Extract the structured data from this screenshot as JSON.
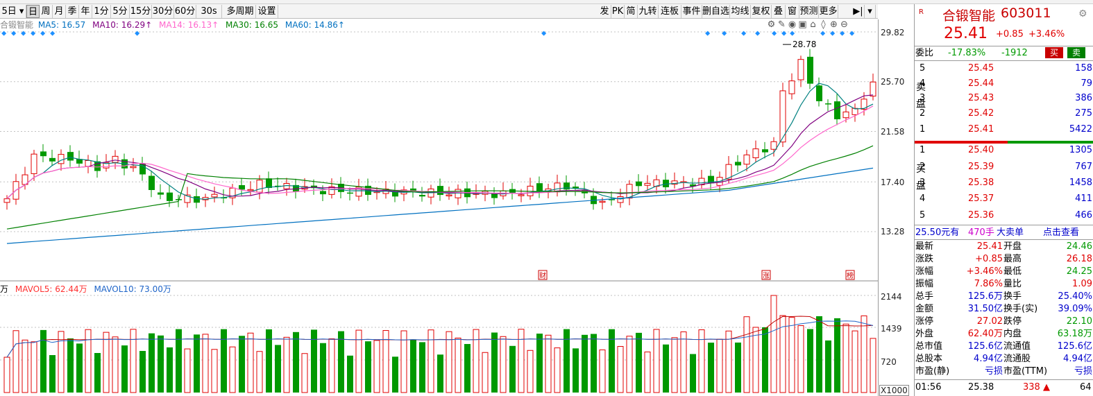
{
  "toolbar": {
    "period_label": "5日",
    "buttons": [
      "日",
      "周",
      "月",
      "季",
      "年",
      "1分",
      "5分",
      "15分",
      "30分",
      "60分",
      "30s",
      "多周期",
      "设置"
    ],
    "active": "日",
    "right_buttons": [
      "发",
      "PK",
      "简",
      "九转",
      "连板",
      "事件",
      "删自选",
      "均线",
      "复权",
      "叠",
      "窗",
      "预测",
      "更多"
    ]
  },
  "chart": {
    "ma_legend": {
      "name": "合锻智能",
      "ma5": "MA5: 16.57",
      "ma10": "MA10: 16.29↑",
      "ma14": "MA14: 16.13↑",
      "ma30": "MA30: 16.65",
      "ma60": "MA60: 14.86↑"
    },
    "price_axis": [
      "29.82",
      "25.70",
      "21.58",
      "17.40",
      "13.28"
    ],
    "high_label": "28.78",
    "event_markers": [
      "财",
      "涨",
      "榜"
    ],
    "vol_legend": {
      "unit": "万",
      "mavol5": "MAVOL5: 62.44万",
      "mavol10": "MAVOL10: 73.00万"
    },
    "vol_axis": [
      "2144",
      "1439",
      "720"
    ],
    "vol_unit": "X1000",
    "colors": {
      "up": "#e00000",
      "down": "#009900",
      "ma5": "#008080",
      "ma10": "#800080",
      "ma14": "#ff66cc",
      "ma30": "#008000",
      "ma60": "#0070c0"
    }
  },
  "panel": {
    "stock_name": "合锻智能",
    "code": "603011",
    "price": "25.41",
    "change": "+0.85",
    "change_pct": "+3.46%",
    "weibi_label": "委比",
    "weibi_pct": "-17.83%",
    "weicha": "-1912",
    "buy_label": "买",
    "sell_label": "卖",
    "sell_side": "卖盘",
    "buy_side": "买盘",
    "asks": [
      {
        "lvl": "5",
        "price": "25.45",
        "vol": "158"
      },
      {
        "lvl": "4",
        "price": "25.44",
        "vol": "79"
      },
      {
        "lvl": "3",
        "price": "25.43",
        "vol": "386"
      },
      {
        "lvl": "2",
        "price": "25.42",
        "vol": "275"
      },
      {
        "lvl": "1",
        "price": "25.41",
        "vol": "5422"
      }
    ],
    "bids": [
      {
        "lvl": "1",
        "price": "25.40",
        "vol": "1305"
      },
      {
        "lvl": "2",
        "price": "25.39",
        "vol": "767"
      },
      {
        "lvl": "3",
        "price": "25.38",
        "vol": "1458"
      },
      {
        "lvl": "4",
        "price": "25.37",
        "vol": "411"
      },
      {
        "lvl": "5",
        "price": "25.36",
        "vol": "466"
      }
    ],
    "bigorder": {
      "price": "25.50元有",
      "qty": "470手",
      "label": "大卖单",
      "link": "点击查看"
    },
    "stats": [
      {
        "l1": "最新",
        "v1": "25.41",
        "c1": "red",
        "l2": "开盘",
        "v2": "24.46",
        "c2": "grn"
      },
      {
        "l1": "涨跌",
        "v1": "+0.85",
        "c1": "red",
        "l2": "最高",
        "v2": "26.18",
        "c2": "red"
      },
      {
        "l1": "涨幅",
        "v1": "+3.46%",
        "c1": "red",
        "l2": "最低",
        "v2": "24.25",
        "c2": "grn"
      },
      {
        "l1": "振幅",
        "v1": "7.86%",
        "c1": "red",
        "l2": "量比",
        "v2": "1.09",
        "c2": "red"
      },
      {
        "l1": "总手",
        "v1": "125.6万",
        "c1": "blu",
        "l2": "换手",
        "v2": "25.40%",
        "c2": "blu"
      },
      {
        "l1": "金额",
        "v1": "31.50亿",
        "c1": "blu",
        "l2": "换手(实)",
        "v2": "39.09%",
        "c2": "blu"
      },
      {
        "l1": "涨停",
        "v1": "27.02",
        "c1": "red",
        "l2": "跌停",
        "v2": "22.10",
        "c2": "grn"
      },
      {
        "l1": "外盘",
        "v1": "62.40万",
        "c1": "red",
        "l2": "内盘",
        "v2": "63.18万",
        "c2": "grn"
      },
      {
        "l1": "总市值",
        "v1": "125.6亿",
        "c1": "blu",
        "l2": "流通值",
        "v2": "125.6亿",
        "c2": "blu"
      },
      {
        "l1": "总股本",
        "v1": "4.94亿",
        "c1": "blu",
        "l2": "流通股",
        "v2": "4.94亿",
        "c2": "blu"
      },
      {
        "l1": "市盈(静)",
        "v1": "亏损",
        "c1": "blu",
        "l2": "市盈(TTM)",
        "v2": "亏损",
        "c2": "blu"
      }
    ],
    "tick": {
      "time": "01:56",
      "price": "25.38",
      "vol": "338",
      "extra": "64"
    }
  }
}
